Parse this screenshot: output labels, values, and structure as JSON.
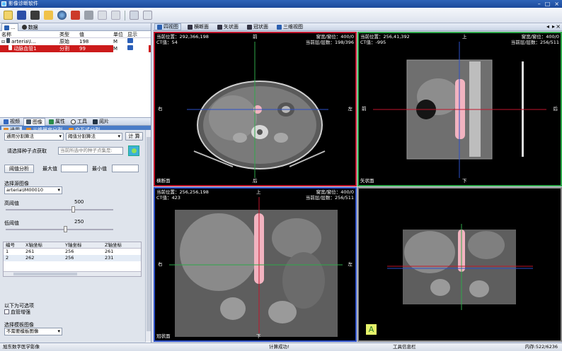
{
  "window": {
    "title": "影像诊断软件"
  },
  "toolbar": {
    "icons": [
      "new-icon",
      "save-icon",
      "open-icon",
      "folder-icon",
      "sphere-icon",
      "cut-icon",
      "paste-icon",
      "undo-icon",
      "redo-icon",
      "copy-icon",
      "window-icon"
    ]
  },
  "left_tabs": {
    "tab1": "...",
    "tab2": "数据"
  },
  "data_list": {
    "headers": {
      "name": "名称",
      "type": "类型",
      "value": "值",
      "unit": "单位",
      "display": "显示"
    },
    "rows": [
      {
        "name": "arteria\\I...",
        "type": "原始",
        "value": "198",
        "unit": "M",
        "display": "eye-icon"
      },
      {
        "name": "动脉血管1",
        "type": "分割",
        "value": "99",
        "unit": "M",
        "display": "eye-icon"
      }
    ]
  },
  "tool_tabs": {
    "t1": "视频",
    "t2": "图像",
    "t3": "属性",
    "t4": "工具",
    "t5": "阅片"
  },
  "seg_tabs": {
    "t1": "通用",
    "t2": "三维器官分割",
    "t3": "交互式分割"
  },
  "form": {
    "algo_select": "通用分割算法",
    "threshold_select": "阈值分割算法",
    "compute_button": "计 算",
    "seed_label": "请选择种子点获取",
    "seed_placeholder": "当前所选中的种子点集是:",
    "threshold_analysis_button": "阈值分析",
    "max_label": "最大值",
    "min_label": "最小值",
    "source_label": "选择源图像",
    "source_select": "arteria\\IM00010",
    "high_label": "高阈值",
    "high_value": "500",
    "low_label": "低阈值",
    "low_value": "250",
    "seed_table": {
      "headers": [
        "编号",
        "X轴坐标",
        "Y轴坐标",
        "Z轴坐标"
      ],
      "rows": [
        [
          "1",
          "261",
          "256",
          "261"
        ],
        [
          "2",
          "262",
          "256",
          "231"
        ]
      ]
    },
    "options_label": "以下为可选项",
    "vessel_checkbox": "血管增强",
    "template_label": "选择模板图像",
    "template_select": "不需要模板图像"
  },
  "view_tabs": {
    "t1": "四视图",
    "t2": "横断面",
    "t3": "矢状面",
    "t4": "冠状面",
    "t5": "三维视图"
  },
  "views": {
    "axial": {
      "pos": "当前位置：292,366,198",
      "ct": "CT值：54",
      "ww": "窗宽/窗位：400/0",
      "layer": "当前层/层数：198/396",
      "top": "前",
      "bottom": "后",
      "left": "右",
      "right": "左",
      "name": "横断面",
      "border": "#c0152c"
    },
    "sagittal": {
      "pos": "当前位置：256,41,392",
      "ct": "CT值：-995",
      "ww": "窗宽/窗位：400/0",
      "layer": "当前层/层数：256/511",
      "top": "上",
      "bottom": "下",
      "left": "前",
      "right": "后",
      "name": "矢状面",
      "border": "#2ea84a"
    },
    "coronal": {
      "pos": "当前位置：256,256,198",
      "ct": "CT值：423",
      "ww": "窗宽/窗位：400/0",
      "layer": "当前层/层数：256/511",
      "top": "上",
      "bottom": "下",
      "left": "右",
      "right": "左",
      "name": "冠状面",
      "border": "#2c4fc7"
    },
    "three_d": {
      "badge": "A",
      "border": "#888888"
    }
  },
  "status": {
    "left": "旭东数字医学影像",
    "center": "计算成功!",
    "tool": "工具信息栏",
    "memory": "内存:522/6236"
  }
}
